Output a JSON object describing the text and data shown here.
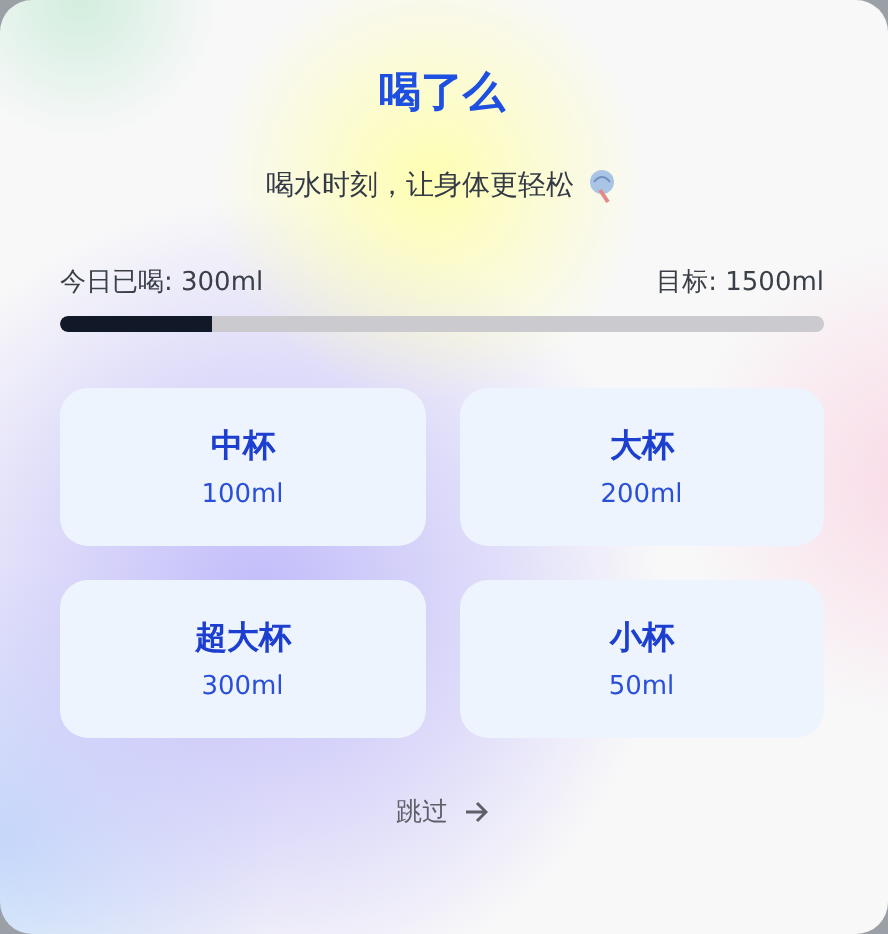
{
  "title": "喝了么",
  "subtitle": "喝水时刻，让身体更轻松",
  "progress": {
    "consumed_label": "今日已喝: 300ml",
    "goal_label": "目标: 1500ml",
    "level": 0.2
  },
  "cups": [
    {
      "name": "中杯",
      "amount": "100ml"
    },
    {
      "name": "大杯",
      "amount": "200ml"
    },
    {
      "name": "超大杯",
      "amount": "300ml"
    },
    {
      "name": "小杯",
      "amount": "50ml"
    }
  ],
  "skip": {
    "label": "跳过"
  }
}
